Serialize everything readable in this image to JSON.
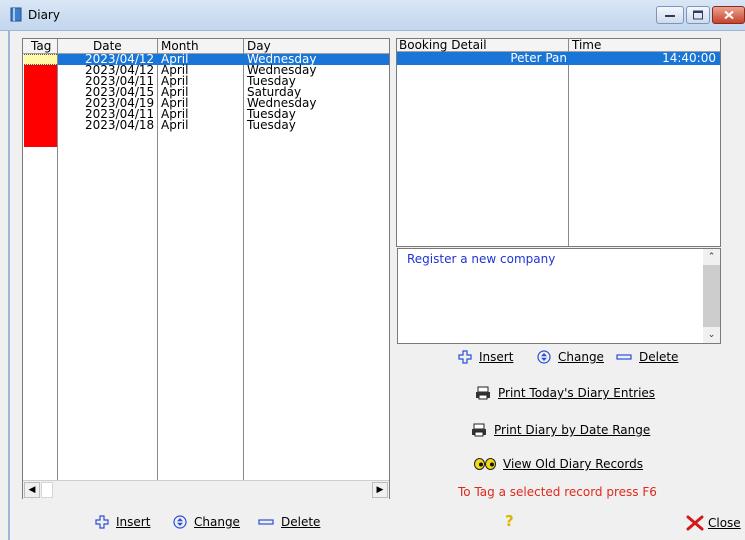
{
  "window": {
    "title": "Diary"
  },
  "diary_list": {
    "headers": [
      "Tag",
      "Date",
      "Month",
      "Day"
    ],
    "rows": [
      {
        "date": "2023/04/12",
        "month": "April",
        "day": "Wednesday",
        "tag_color": "#fff9a8",
        "selected": true
      },
      {
        "date": "2023/04/12",
        "month": "April",
        "day": "Wednesday",
        "tag_color": "#ff0000",
        "selected": false
      },
      {
        "date": "2023/04/11",
        "month": "April",
        "day": "Tuesday",
        "tag_color": "#ff0000",
        "selected": false
      },
      {
        "date": "2023/04/15",
        "month": "April",
        "day": "Saturday",
        "tag_color": "#ff0000",
        "selected": false
      },
      {
        "date": "2023/04/19",
        "month": "April",
        "day": "Wednesday",
        "tag_color": "#ff0000",
        "selected": false
      },
      {
        "date": "2023/04/11",
        "month": "April",
        "day": "Tuesday",
        "tag_color": "#ff0000",
        "selected": false
      },
      {
        "date": "2023/04/18",
        "month": "April",
        "day": "Tuesday",
        "tag_color": "#ff0000",
        "selected": false
      }
    ]
  },
  "booking": {
    "headers": [
      "Booking Detail",
      "Time"
    ],
    "rows": [
      {
        "detail": "Peter Pan",
        "time": "14:40:00",
        "selected": true
      }
    ]
  },
  "notes": {
    "text": "Register a new company"
  },
  "right_actions": {
    "insert": "Insert",
    "change": "Change",
    "delete": "Delete"
  },
  "print_today": "Print Today's Diary Entries",
  "print_range": "Print Diary by Date Range",
  "view_old": "View Old Diary Records",
  "hint": "To Tag a selected record press F6",
  "bottom_actions": {
    "insert": "Insert",
    "change": "Change",
    "delete": "Delete"
  },
  "help_icon": "question-mark-icon",
  "close": "Close",
  "colors": {
    "selection": "#1976d6",
    "tag_red": "#ff0000",
    "tag_yellow": "#fff9a8",
    "notes_text": "#1f35d3",
    "hint_red": "#e0281d"
  }
}
